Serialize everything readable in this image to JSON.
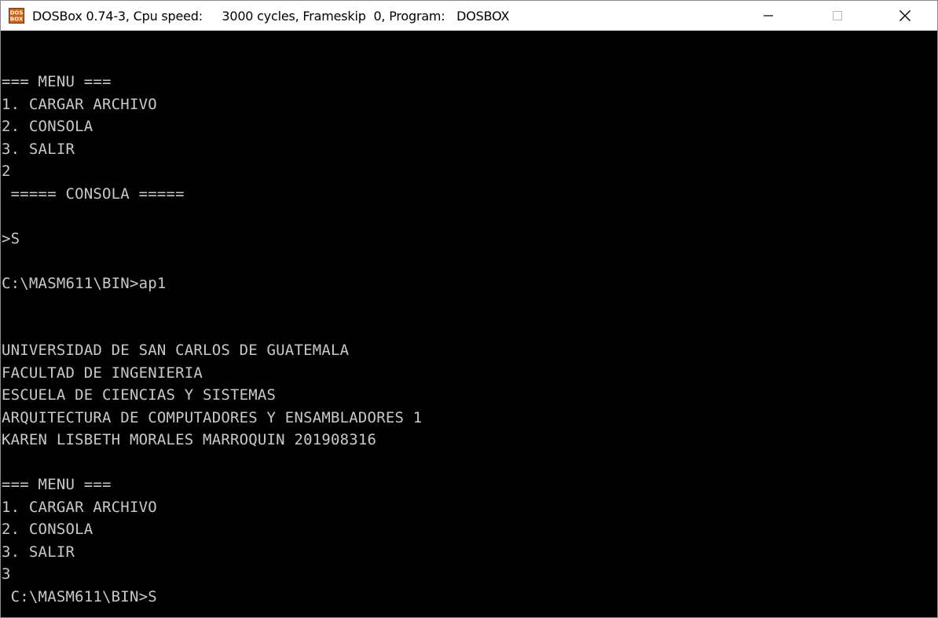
{
  "window": {
    "title": "DOSBox 0.74-3, Cpu speed:     3000 cycles, Frameskip  0, Program:   DOSBOX",
    "icon": "dosbox-icon",
    "icon_text": "DOS BOX",
    "controls": {
      "minimize_icon": "minimize-icon",
      "maximize_icon": "maximize-icon",
      "close_icon": "close-icon"
    }
  },
  "colors": {
    "terminal_background": "#000000",
    "terminal_text": "#c9c9c9",
    "titlebar_background": "#ffffff"
  },
  "terminal": {
    "lines": [
      "=== MENU ===",
      "1. CARGAR ARCHIVO",
      "2. CONSOLA",
      "3. SALIR",
      "2",
      " ===== CONSOLA =====",
      "",
      ">S",
      "",
      "C:\\MASM611\\BIN>ap1",
      "",
      "",
      "UNIVERSIDAD DE SAN CARLOS DE GUATEMALA",
      "FACULTAD DE INGENIERIA",
      "ESCUELA DE CIENCIAS Y SISTEMAS",
      "ARQUITECTURA DE COMPUTADORES Y ENSAMBLADORES 1",
      "KAREN LISBETH MORALES MARROQUIN 201908316",
      "",
      "=== MENU ===",
      "1. CARGAR ARCHIVO",
      "2. CONSOLA",
      "3. SALIR",
      "3",
      " C:\\MASM611\\BIN>S"
    ]
  }
}
